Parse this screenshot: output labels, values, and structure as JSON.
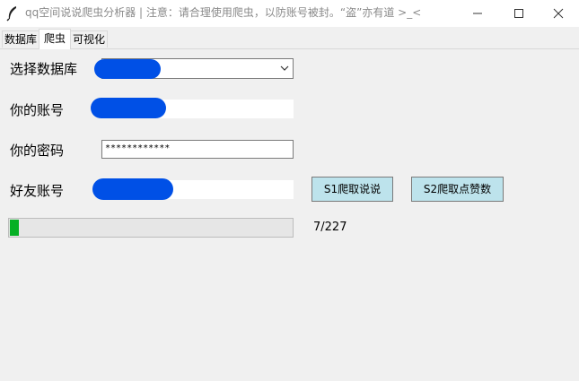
{
  "window": {
    "title": "qq空间说说爬虫分析器 | 注意：请合理使用爬虫，以防账号被封。“盗”亦有道 >_<"
  },
  "tabs": [
    {
      "label": "数据库",
      "active": false
    },
    {
      "label": "爬虫",
      "active": true
    },
    {
      "label": "可视化",
      "active": false
    }
  ],
  "form": {
    "database_label": "选择数据库",
    "account_label": "你的账号",
    "password_label": "你的密码",
    "password_value": "************",
    "friend_label": "好友账号"
  },
  "buttons": {
    "s1_label": "S1爬取说说",
    "s2_label": "S2爬取点赞数"
  },
  "progress": {
    "text": "7/227",
    "fraction": 0.0308
  },
  "colors": {
    "accent_button": "#bde3ec",
    "progress_fill": "#06b025",
    "redaction": "#0050e6"
  }
}
